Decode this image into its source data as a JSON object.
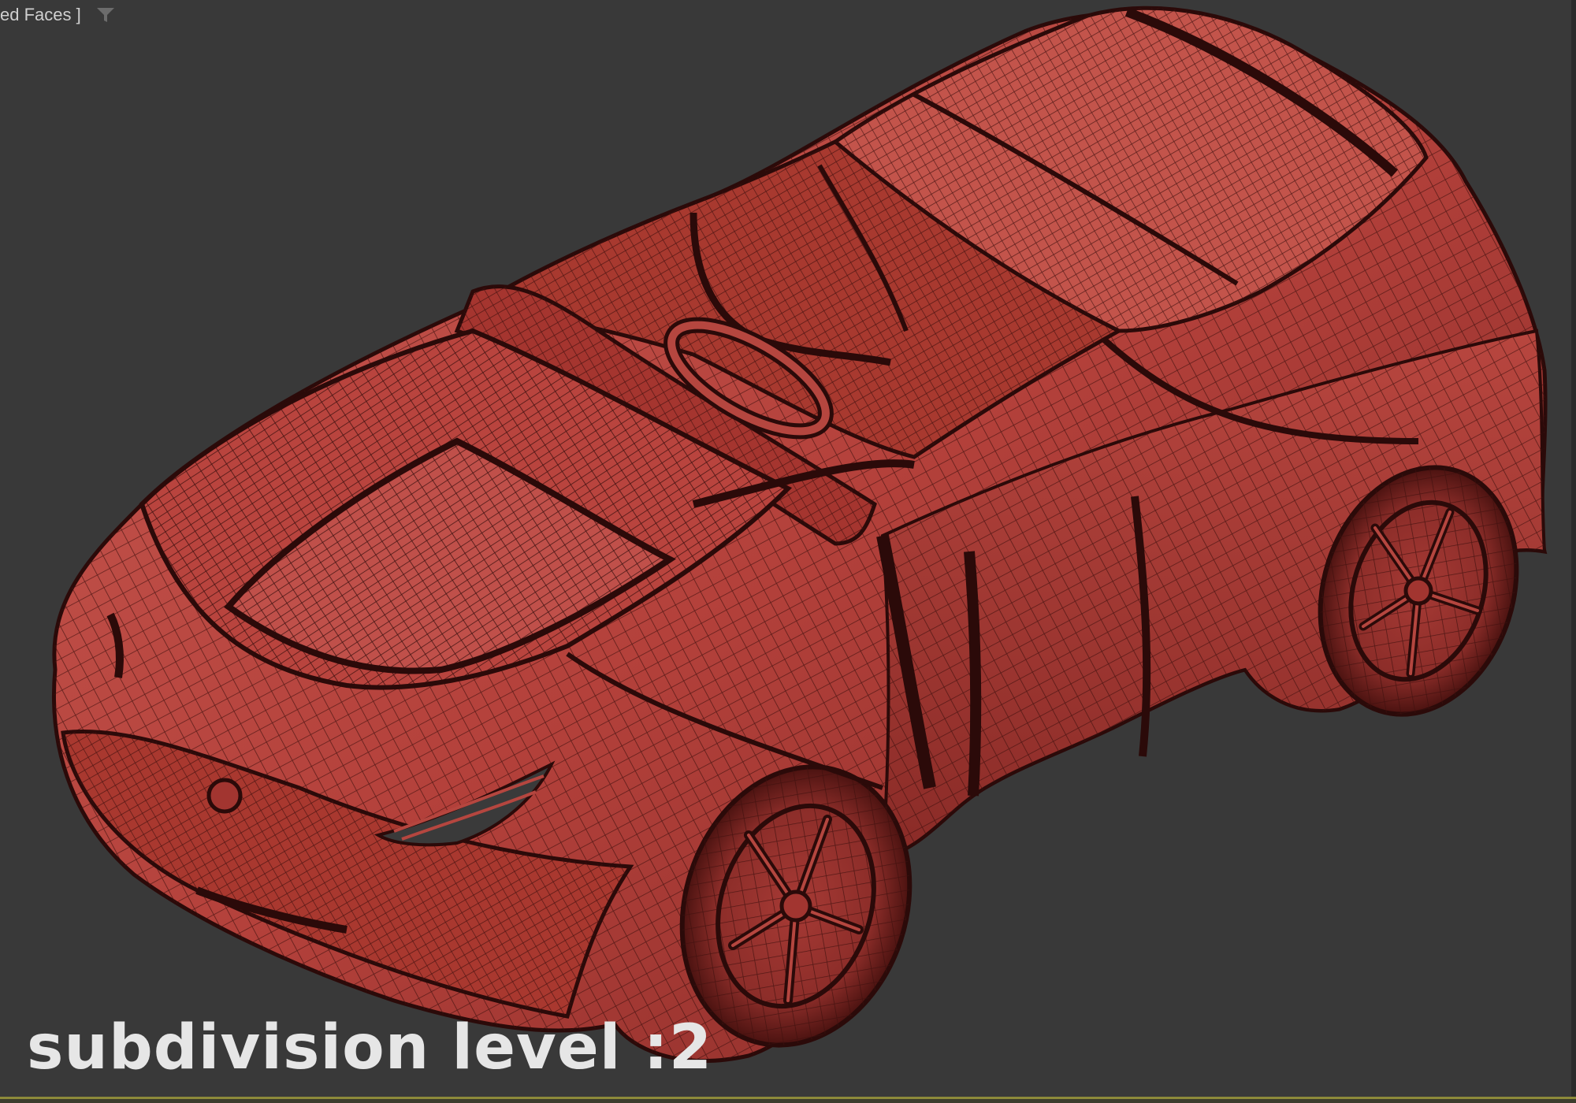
{
  "viewport": {
    "label": "ed Faces ]",
    "filter_icon": "filter-icon",
    "background": "#393939"
  },
  "model": {
    "subject": "car-wireframe-icon",
    "base_color": "#b9443e",
    "shadow_color": "#6d1d1b",
    "wire_color": "#3d0f0d"
  },
  "overlay": {
    "caption": "subdivision level :2"
  }
}
